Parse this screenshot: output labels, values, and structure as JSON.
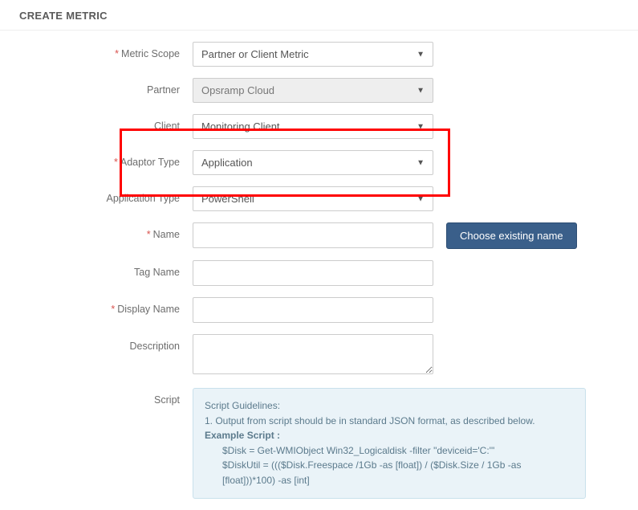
{
  "page": {
    "title": "CREATE METRIC"
  },
  "labels": {
    "metric_scope": "Metric Scope",
    "partner": "Partner",
    "client": "Client",
    "adaptor_type": "Adaptor Type",
    "application_type": "Application Type",
    "name": "Name",
    "tag_name": "Tag Name",
    "display_name": "Display Name",
    "description": "Description",
    "script": "Script"
  },
  "values": {
    "metric_scope": "Partner or Client Metric",
    "partner": "Opsramp Cloud",
    "client": "Monitoring Client",
    "adaptor_type": "Application",
    "application_type": "PowerShell",
    "name": "",
    "tag_name": "",
    "display_name": "",
    "description": ""
  },
  "buttons": {
    "choose_existing": "Choose existing name"
  },
  "script_panel": {
    "heading": "Script Guidelines:",
    "line1": "1. Output from script should be in standard JSON format, as described below.",
    "example_label": "Example Script :",
    "code1": "$Disk = Get-WMIObject Win32_Logicaldisk -filter \"deviceid='C:'\"",
    "code2": "$DiskUtil = ((($Disk.Freespace /1Gb -as [float]) / ($Disk.Size / 1Gb -as [float]))*100) -as [int]"
  }
}
